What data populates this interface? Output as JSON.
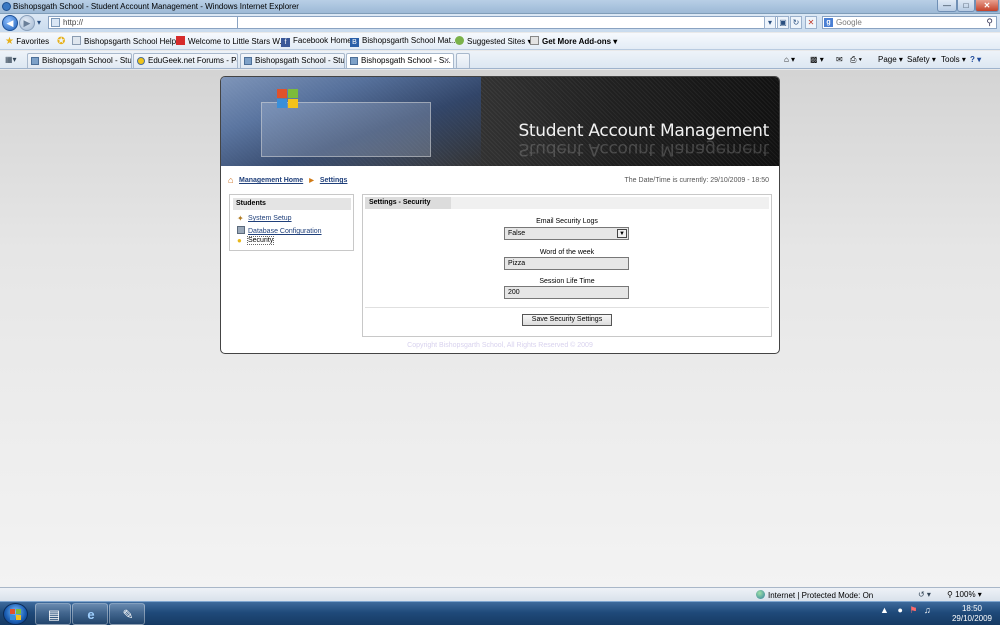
{
  "browser": {
    "window_title": "Bishopsgath School - Student Account Management - Windows Internet Explorer",
    "address": "http://",
    "search_placeholder": "Google",
    "favorites_label": "Favorites",
    "favorites": [
      "Bishopsgarth School Help...",
      "Welcome to Little Stars W...",
      "Facebook  Home",
      "Bishopsgarth School Mat...",
      "Suggested Sites ▾",
      "Get More Add-ons ▾"
    ],
    "tabs": [
      "Bishopsgath School - Stud...",
      "EduGeek.net Forums - Pos...",
      "Bishopsgath School - Stud...",
      "Bishopsgath School - S..."
    ],
    "toolbar": {
      "page": "Page ▾",
      "safety": "Safety ▾",
      "tools": "Tools ▾",
      "help": "?"
    }
  },
  "site": {
    "banner_title": "Student Account Management",
    "breadcrumb": {
      "home": "Management Home",
      "current": "Settings"
    },
    "datetime": "The Date/Time is currently: 29/10/2009 - 18:50",
    "sidebar": {
      "heading": "Students",
      "items": [
        {
          "label": "System Setup",
          "icon": "tools-icon"
        },
        {
          "label": "Database Configuration",
          "icon": "database-icon"
        },
        {
          "label": "Security",
          "icon": "lightbulb-icon"
        }
      ]
    },
    "panel": {
      "title": "Settings - Security",
      "email_logs_label": "Email Security Logs",
      "email_logs_value": "False",
      "word_label": "Word of the week",
      "word_value": "Pizza",
      "session_label": "Session Life Time",
      "session_value": "200",
      "save_button": "Save Security Settings"
    },
    "copyright": "Copyright Bishopsgarth School, All Rights Reserved © 2009"
  },
  "status": {
    "zone": "Internet | Protected Mode: On",
    "zoom": "100%"
  },
  "taskbar": {
    "time": "18:50",
    "date": "29/10/2009"
  },
  "colors": {
    "link": "#1f3f7a",
    "accent": "#d07a16",
    "taskbar": "#1f4a7a"
  }
}
